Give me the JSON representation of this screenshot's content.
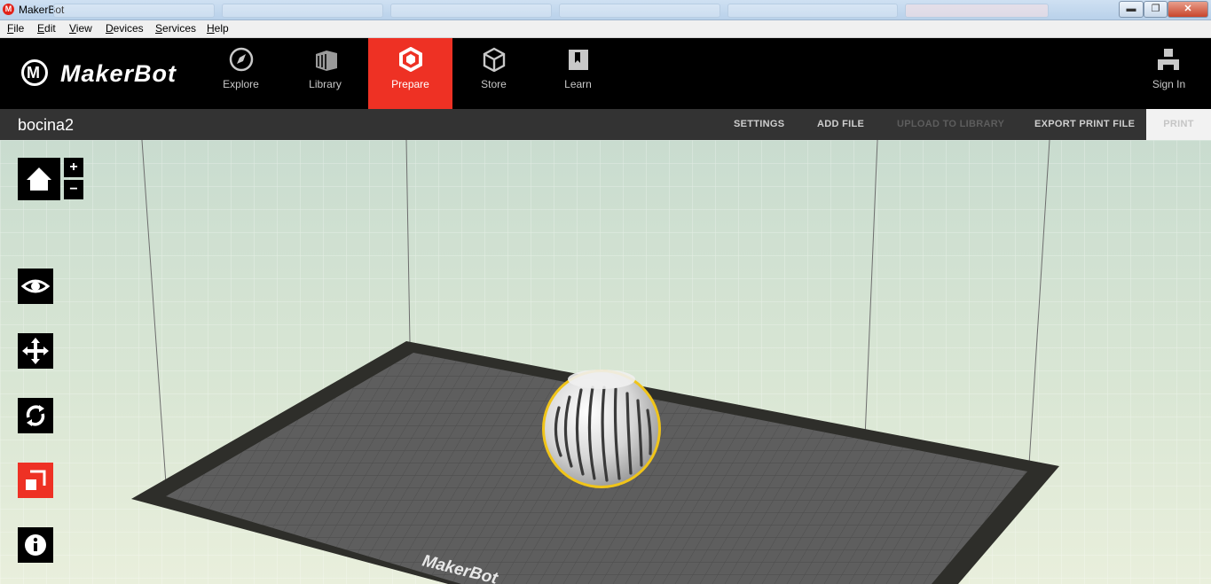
{
  "window": {
    "title": "MakerBot",
    "app_icon_letter": "M",
    "background_tabs": [
      "",
      "",
      "",
      "",
      "",
      ""
    ],
    "controls": {
      "minimize": "▬",
      "maximize": "❐",
      "close": "✕"
    }
  },
  "menu": {
    "items": [
      "File",
      "Edit",
      "View",
      "Devices",
      "Services",
      "Help"
    ]
  },
  "nav": {
    "logo_text": "MakerBot",
    "items": [
      {
        "label": "Explore",
        "icon": "compass-icon"
      },
      {
        "label": "Library",
        "icon": "library-stack-icon"
      },
      {
        "label": "Prepare",
        "icon": "prepare-hexagon-icon",
        "active": true
      },
      {
        "label": "Store",
        "icon": "cube-icon"
      },
      {
        "label": "Learn",
        "icon": "book-icon"
      }
    ],
    "sign_in": {
      "label": "Sign In",
      "icon": "user-icon"
    }
  },
  "toolbar": {
    "document_title": "bocina2",
    "actions": [
      {
        "label": "SETTINGS",
        "enabled": true
      },
      {
        "label": "ADD FILE",
        "enabled": true
      },
      {
        "label": "UPLOAD TO LIBRARY",
        "enabled": false
      },
      {
        "label": "EXPORT PRINT FILE",
        "enabled": true
      }
    ],
    "print_label": "PRINT",
    "print_enabled": false
  },
  "viewport": {
    "zoom_in": "+",
    "zoom_out": "−",
    "tools": [
      {
        "name": "view",
        "icon": "eye-icon",
        "active": false
      },
      {
        "name": "move",
        "icon": "move-arrows-icon",
        "active": false
      },
      {
        "name": "rotate",
        "icon": "rotate-icon",
        "active": false
      },
      {
        "name": "scale",
        "icon": "scale-icon",
        "active": true
      },
      {
        "name": "object-info",
        "icon": "info-icon",
        "active": false
      }
    ],
    "plate_brand_text": "MakerBot",
    "selected_object": "speaker-sphere-model"
  },
  "colors": {
    "accent": "#ee3124",
    "nav_bg": "#000000",
    "subbar_bg": "#333333",
    "selection_outline": "#f0c419",
    "plate": "#5e5e5e",
    "plate_border": "#2e2e2a"
  }
}
